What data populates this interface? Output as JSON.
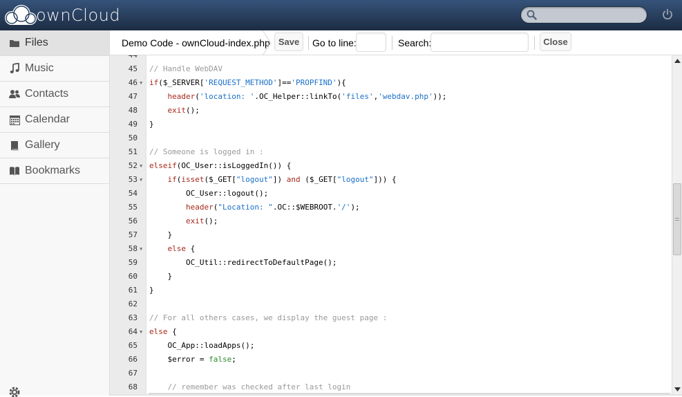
{
  "header": {
    "brand": "ownCloud",
    "search": {
      "placeholder": "",
      "value": ""
    }
  },
  "sidebar": {
    "items": [
      {
        "label": "Files",
        "icon": "folder-icon",
        "active": true
      },
      {
        "label": "Music",
        "icon": "music-note-icon",
        "active": false
      },
      {
        "label": "Contacts",
        "icon": "people-icon",
        "active": false
      },
      {
        "label": "Calendar",
        "icon": "calendar-icon",
        "active": false
      },
      {
        "label": "Gallery",
        "icon": "picture-icon",
        "active": false
      },
      {
        "label": "Bookmarks",
        "icon": "bookmark-icon",
        "active": false
      }
    ]
  },
  "controls": {
    "breadcrumb": "Demo Code - ownCloud-index.php",
    "save_label": "Save",
    "goto_label": "Go to line:",
    "goto_value": "",
    "search_label": "Search:",
    "search_value": "",
    "close_label": "Close"
  },
  "editor": {
    "lines": [
      {
        "n": "44",
        "fold": false,
        "html": ""
      },
      {
        "n": "45",
        "fold": false,
        "html": "<span class='cmt'>// Handle WebDAV</span>"
      },
      {
        "n": "46",
        "fold": true,
        "html": "<span class='kw'>if</span>($_SERVER[<span class='str'>'REQUEST_METHOD'</span>]==<span class='str'>'PROPFIND'</span>){"
      },
      {
        "n": "47",
        "fold": false,
        "html": "    <span class='kw'>header</span>(<span class='str'>'location: '</span>.OC_Helper::linkTo(<span class='str'>'files'</span>,<span class='str'>'webdav.php'</span>));"
      },
      {
        "n": "48",
        "fold": false,
        "html": "    <span class='kw'>exit</span>();"
      },
      {
        "n": "49",
        "fold": false,
        "html": "}"
      },
      {
        "n": "50",
        "fold": false,
        "html": ""
      },
      {
        "n": "51",
        "fold": false,
        "html": "<span class='cmt'>// Someone is logged in :</span>"
      },
      {
        "n": "52",
        "fold": true,
        "html": "<span class='kw'>elseif</span>(OC_User::isLoggedIn()) {"
      },
      {
        "n": "53",
        "fold": true,
        "html": "    <span class='kw'>if</span>(<span class='kw'>isset</span>($_GET[<span class='str'>\"logout\"</span>]) <span class='kw'>and</span> ($_GET[<span class='str'>\"logout\"</span>])) {"
      },
      {
        "n": "54",
        "fold": false,
        "html": "        OC_User::logout();"
      },
      {
        "n": "55",
        "fold": false,
        "html": "        <span class='kw'>header</span>(<span class='str'>\"Location: \"</span>.OC::$WEBROOT.<span class='str'>'/'</span>);"
      },
      {
        "n": "56",
        "fold": false,
        "html": "        <span class='kw'>exit</span>();"
      },
      {
        "n": "57",
        "fold": false,
        "html": "    }"
      },
      {
        "n": "58",
        "fold": true,
        "html": "    <span class='kw'>else</span> {"
      },
      {
        "n": "59",
        "fold": false,
        "html": "        OC_Util::redirectToDefaultPage();"
      },
      {
        "n": "60",
        "fold": false,
        "html": "    }"
      },
      {
        "n": "61",
        "fold": false,
        "html": "}"
      },
      {
        "n": "62",
        "fold": false,
        "html": ""
      },
      {
        "n": "63",
        "fold": false,
        "html": "<span class='cmt'>// For all others cases, we display the guest page :</span>"
      },
      {
        "n": "64",
        "fold": true,
        "html": "<span class='kw'>else</span> {"
      },
      {
        "n": "65",
        "fold": false,
        "html": "    OC_App::loadApps();"
      },
      {
        "n": "66",
        "fold": false,
        "html": "    $error = <span class='bool'>false</span>;"
      },
      {
        "n": "67",
        "fold": false,
        "html": ""
      },
      {
        "n": "68",
        "fold": false,
        "html": "    <span class='cmt'>// remember was checked after last login</span>"
      }
    ]
  },
  "colors": {
    "header_top": "#35537a",
    "header_bottom": "#1d2d44",
    "string": "#1a6fc8",
    "keyword": "#a6281b",
    "comment": "#999999",
    "boolean": "#2a8c2a"
  }
}
